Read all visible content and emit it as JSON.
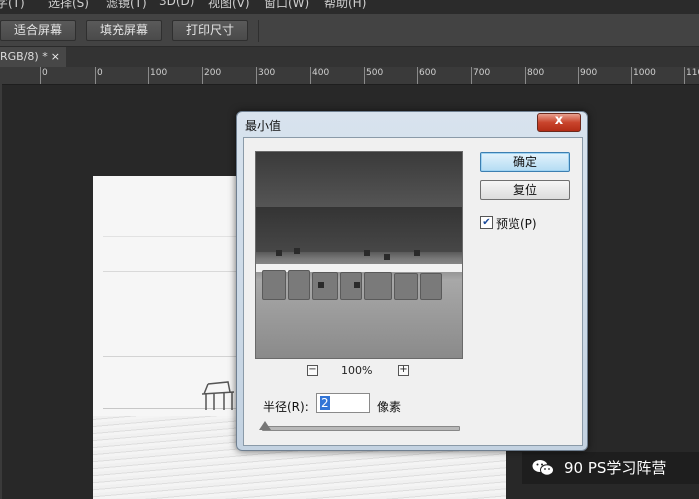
{
  "menubar": {
    "items": [
      "字(T)",
      "选择(S)",
      "滤镜(T)",
      "3D(D)",
      "视图(V)",
      "窗口(W)",
      "帮助(H)"
    ]
  },
  "options": {
    "buttons": [
      "适合屏幕",
      "填充屏幕",
      "打印尺寸"
    ]
  },
  "document_tab": {
    "title": "RGB/8) *",
    "close": "×"
  },
  "ruler": {
    "labels": [
      "0",
      "0",
      "100",
      "200",
      "300",
      "400",
      "500",
      "600",
      "700",
      "800",
      "900",
      "1000",
      "110"
    ]
  },
  "dialog": {
    "title": "最小值",
    "close_glyph": "x",
    "ok_label": "确定",
    "reset_label": "复位",
    "preview_label": "预览(P)",
    "preview_checked": true,
    "zoom_out": "−",
    "zoom_in": "+",
    "zoom_level": "100%",
    "radius_label": "半径(R):",
    "radius_value": "2",
    "radius_unit": "像素",
    "slider_fraction": 0
  },
  "watermark": {
    "text": "90 PS学习阵营",
    "icon": "wechat-icon"
  },
  "colors": {
    "app_bg": "#282828",
    "options_bar": "#434343",
    "dialog_frame": "#c3d2e1",
    "close_button": "#c9442c",
    "default_button": "#b4dcf3",
    "selection": "#3375d6"
  }
}
